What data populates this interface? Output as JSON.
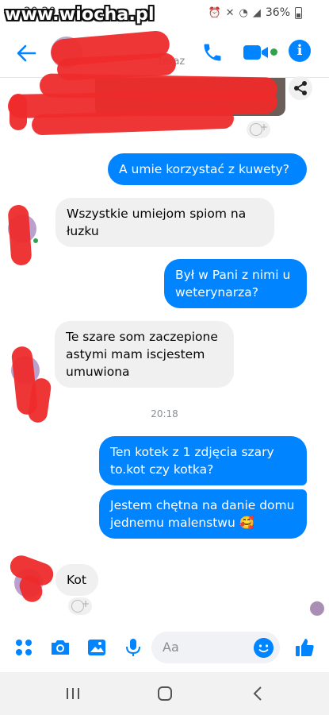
{
  "status_bar": {
    "time": "20:20",
    "battery": "36%"
  },
  "watermark": "www.wiocha.pl",
  "header": {
    "status": "teraz"
  },
  "messages": [
    {
      "id": "m1",
      "direction": "out",
      "text": "A umie korzystać z kuwety?"
    },
    {
      "id": "m2",
      "direction": "in",
      "text": "Wszystkie umiejom spiom na łuzku"
    },
    {
      "id": "m3",
      "direction": "out",
      "text": "Był w Pani z nimi u weterynarza?"
    },
    {
      "id": "m4",
      "direction": "in",
      "text": "Te szare som zaczepione astymi mam iscjestem umuwiona"
    },
    {
      "id": "m5",
      "direction": "out",
      "text": "Ten kotek z 1 zdjęcia szary to.kot czy kotka?"
    },
    {
      "id": "m6",
      "direction": "out",
      "text": "Jestem chętna na danie domu jednemu malenstwu",
      "emoji": "🥰"
    },
    {
      "id": "m7",
      "direction": "in",
      "text": "Kot"
    }
  ],
  "timestamp": "20:18",
  "composer": {
    "placeholder": "Aa"
  },
  "colors": {
    "accent": "#0084ff",
    "redaction": "#ee2b2b",
    "online": "#31a24c"
  },
  "icons": [
    "back-arrow-icon",
    "phone-icon",
    "video-icon",
    "info-icon",
    "share-icon",
    "add-reaction-icon",
    "apps-icon",
    "camera-icon",
    "gallery-icon",
    "microphone-icon",
    "emoji-icon",
    "thumbs-up-icon",
    "recents-icon",
    "home-icon",
    "back-icon"
  ]
}
